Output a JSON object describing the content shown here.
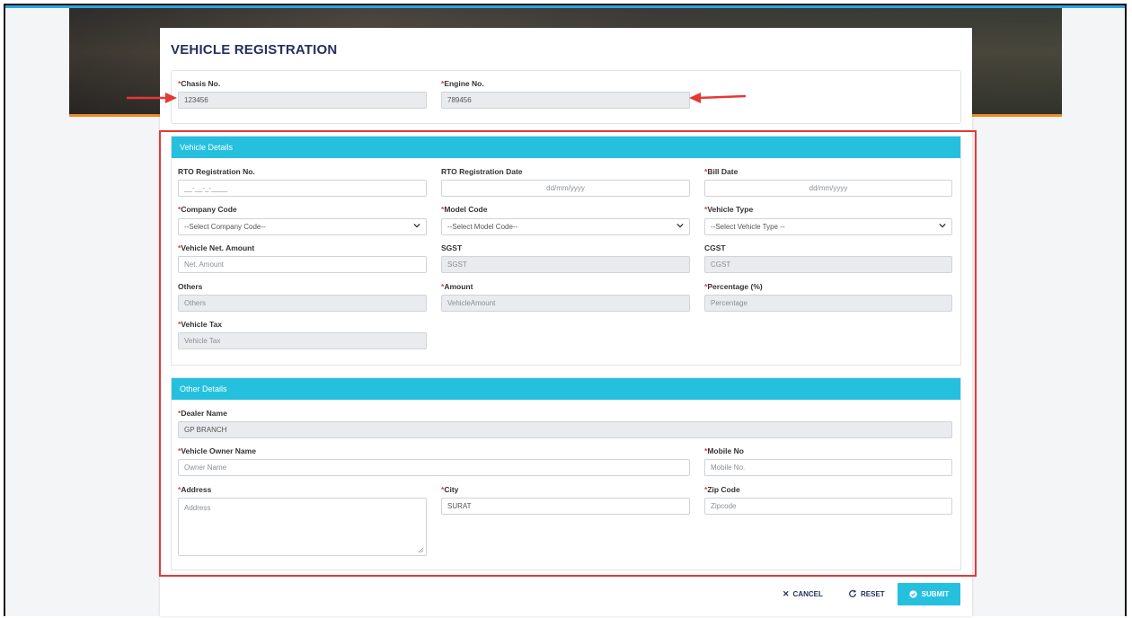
{
  "page": {
    "title": "VEHICLE REGISTRATION"
  },
  "top": {
    "chasis": {
      "label": "Chasis No.",
      "value": "123456"
    },
    "engine": {
      "label": "Engine No.",
      "value": "789456"
    }
  },
  "vehicle_details": {
    "header": "Vehicle Details",
    "rto_no": {
      "label": "RTO Registration No.",
      "placeholder": "__-__-_-____"
    },
    "rto_date": {
      "label": "RTO Registration Date",
      "placeholder": "dd/mm/yyyy"
    },
    "bill_date": {
      "label": "Bill Date",
      "placeholder": "dd/mm/yyyy"
    },
    "company_code": {
      "label": "Company Code",
      "selected": "--Select Company Code--"
    },
    "model_code": {
      "label": "Model Code",
      "selected": "--Select Model Code--"
    },
    "vehicle_type": {
      "label": "Vehicle Type",
      "selected": "--Select Vehicle Type --"
    },
    "net_amount": {
      "label": "Vehicle Net. Amount",
      "placeholder": "Net. Amount"
    },
    "sgst": {
      "label": "SGST",
      "placeholder": "SGST"
    },
    "cgst": {
      "label": "CGST",
      "placeholder": "CGST"
    },
    "others": {
      "label": "Others",
      "placeholder": "Others"
    },
    "amount": {
      "label": "Amount",
      "placeholder": "VehicleAmount"
    },
    "percentage": {
      "label": "Percentage (%)",
      "placeholder": "Percentage"
    },
    "vehicle_tax": {
      "label": "Vehicle Tax",
      "placeholder": "Vehicle Tax"
    }
  },
  "other_details": {
    "header": "Other Details",
    "dealer_name": {
      "label": "Dealer Name",
      "value": "GP BRANCH"
    },
    "owner_name": {
      "label": "Vehicle Owner Name",
      "placeholder": "Owner Name"
    },
    "mobile": {
      "label": "Mobile No",
      "placeholder": "Mobile No."
    },
    "address": {
      "label": "Address",
      "placeholder": "Address"
    },
    "city": {
      "label": "City",
      "value": "SURAT"
    },
    "zip": {
      "label": "Zip Code",
      "placeholder": "Zipcode"
    }
  },
  "footer": {
    "cancel": "CANCEL",
    "reset": "RESET",
    "submit": "SUBMIT"
  },
  "required_mark": "*",
  "colors": {
    "accent": "#26c0df",
    "title": "#253060",
    "required": "#e23b3b",
    "annotation": "#e53935"
  },
  "icons": {
    "cancel": "close-icon",
    "reset": "refresh-icon",
    "submit": "check-circle-icon",
    "select": "chevron-down-icon"
  }
}
